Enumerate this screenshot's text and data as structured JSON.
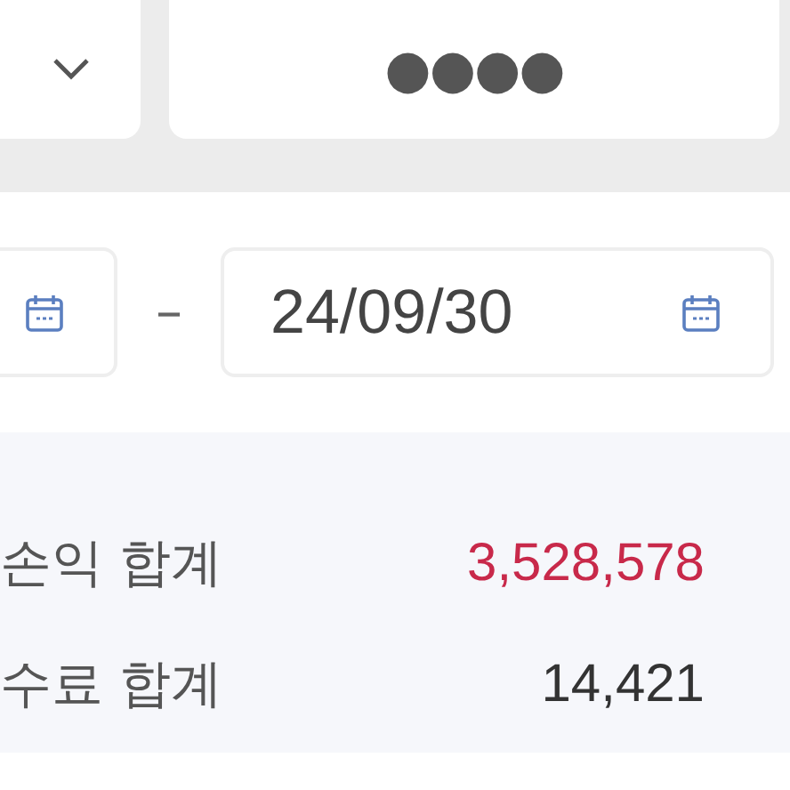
{
  "masked_value": "●●●●",
  "date_range": {
    "separator": "–",
    "end_date": "24/09/30"
  },
  "totals": [
    {
      "label": "손익 합계",
      "value": "3,528,578",
      "kind": "highlight"
    },
    {
      "label": "수료 합계",
      "value": "14,421",
      "kind": "plain"
    }
  ]
}
